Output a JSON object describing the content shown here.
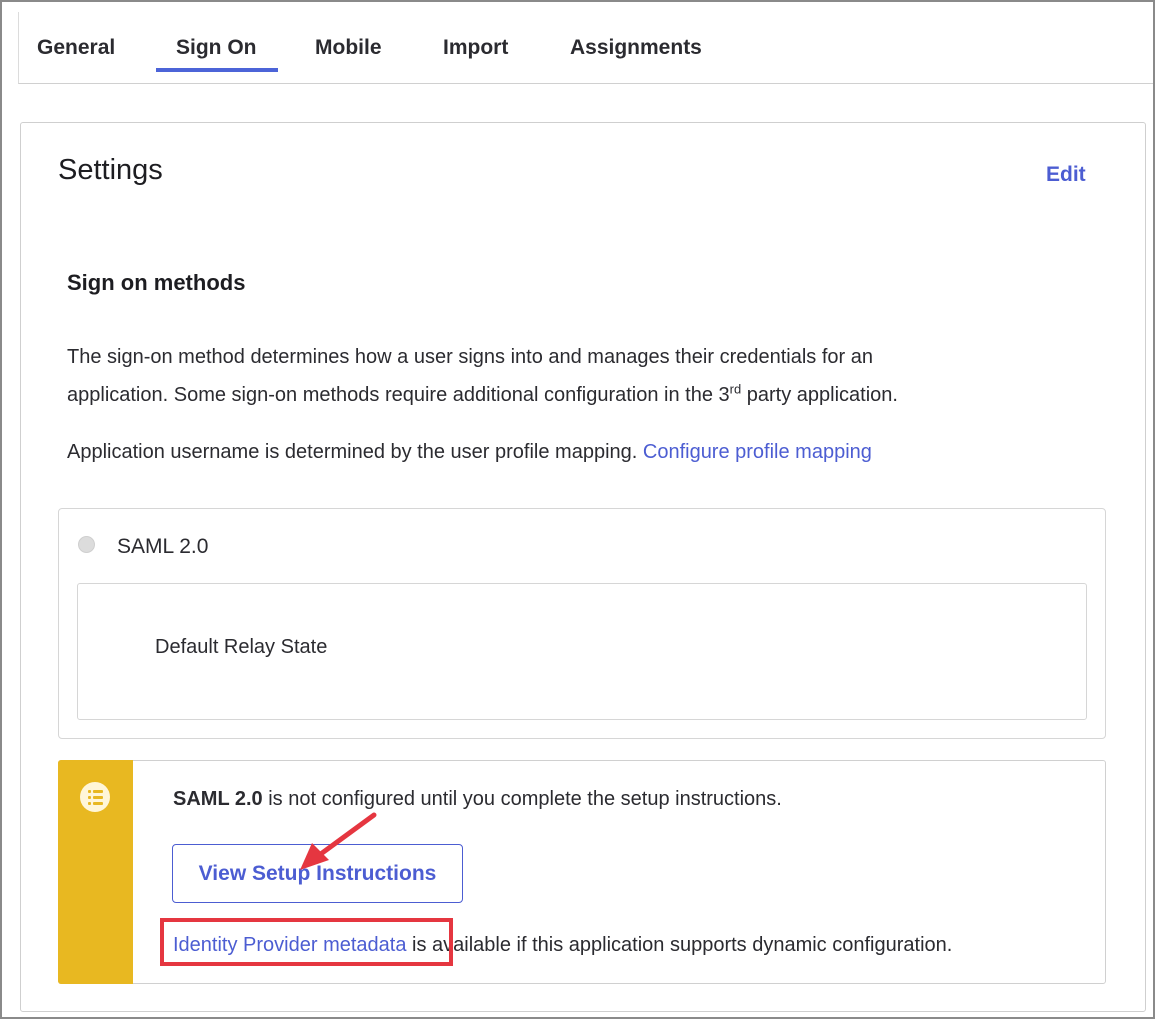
{
  "tabs": [
    {
      "label": "General"
    },
    {
      "label": "Sign On"
    },
    {
      "label": "Mobile"
    },
    {
      "label": "Import"
    },
    {
      "label": "Assignments"
    }
  ],
  "active_tab": "Sign On",
  "settings": {
    "title": "Settings",
    "edit_label": "Edit",
    "methods_title": "Sign on methods",
    "description_line1": "The sign-on method determines how a user signs into and manages their credentials for an",
    "description_line2_a": "application. Some sign-on methods require additional configuration in the 3",
    "description_line2_sup": "rd",
    "description_line2_b": " party application.",
    "username_text": "Application username is determined by the user profile mapping.",
    "configure_link": "Configure profile mapping"
  },
  "saml": {
    "option_label": "SAML 2.0",
    "relay_state_label": "Default Relay State"
  },
  "callout": {
    "bold_text": "SAML 2.0",
    "message": " is not configured until you complete the setup instructions.",
    "button_label": "View Setup Instructions",
    "metadata_link": "Identity Provider metadata",
    "metadata_suffix": " is available if this application supports dynamic configuration.",
    "icon": "list-icon"
  },
  "colors": {
    "accent": "#4c5dd2",
    "tab_underline": "#4c64d8",
    "warning_bar": "#e8b821",
    "annotation_red": "#e53640"
  }
}
